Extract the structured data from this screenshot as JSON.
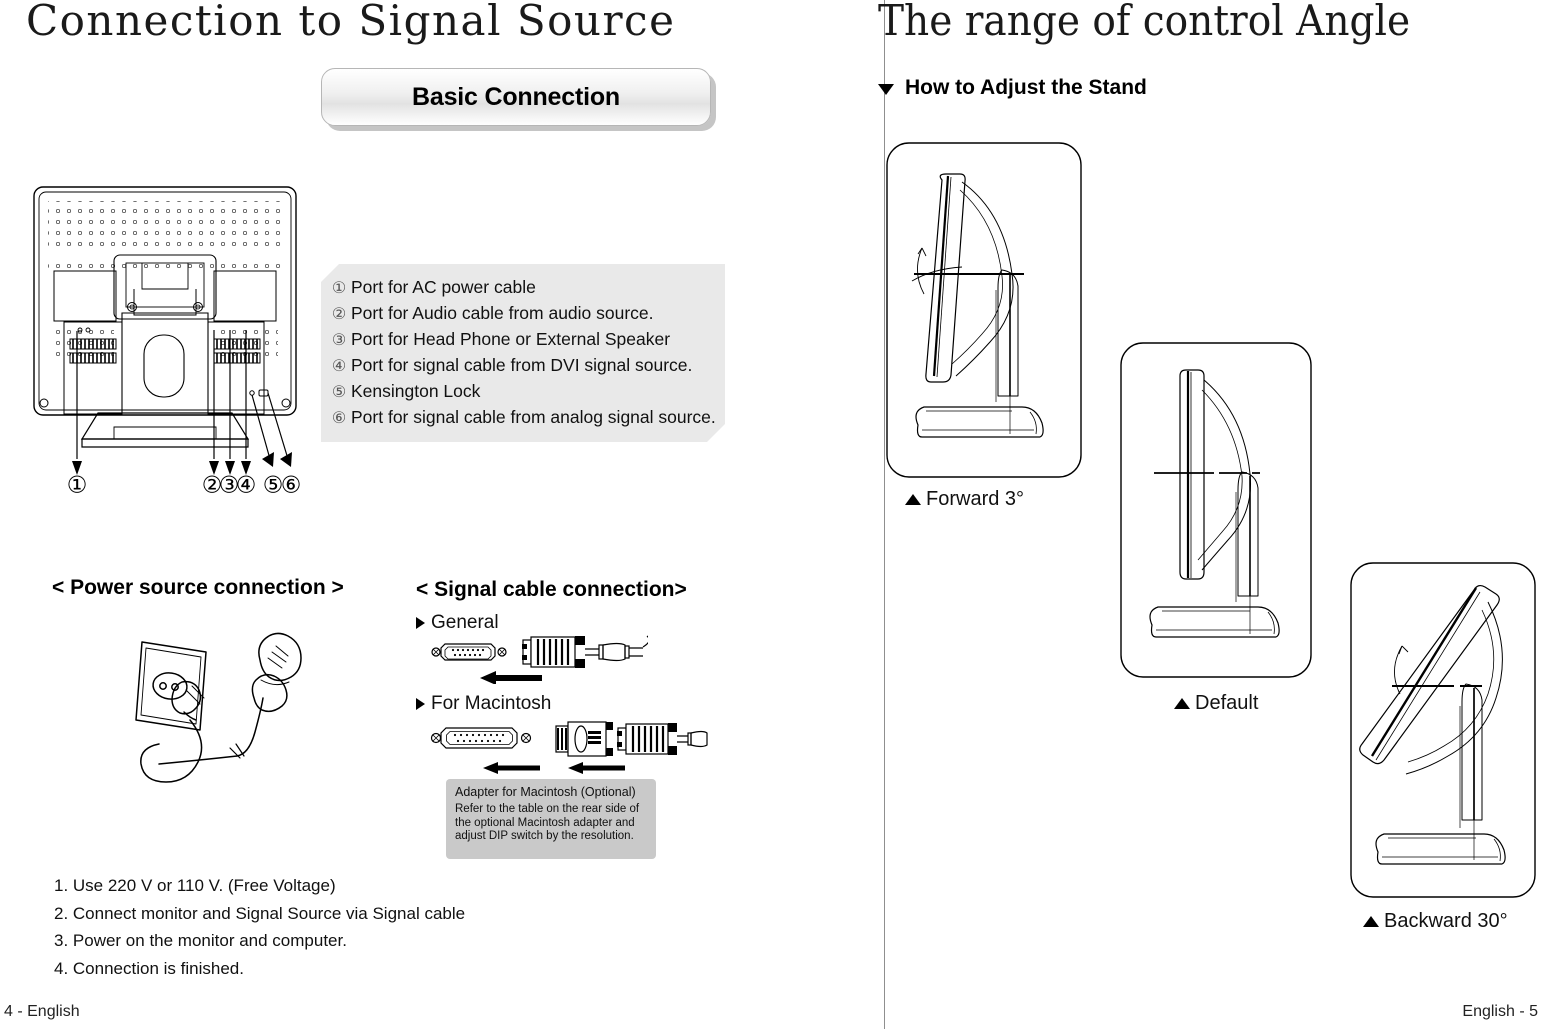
{
  "document": {
    "left_page": {
      "title": "Connection to Signal Source",
      "button_label": "Basic Connection",
      "footer": "4 - English",
      "ports": {
        "items": [
          {
            "number": "①",
            "text": "Port for AC power cable"
          },
          {
            "number": "②",
            "text": "Port for Audio cable  from audio source."
          },
          {
            "number": "③",
            "text": "Port for Head Phone or External Speaker"
          },
          {
            "number": "④",
            "text": "Port for signal cable from DVI signal source."
          },
          {
            "number": "⑤",
            "text": "Kensington Lock"
          },
          {
            "number": "⑥",
            "text": "Port for signal cable from analog signal source."
          }
        ],
        "callout_labels": [
          "①",
          "②",
          "③",
          "④",
          "⑤",
          "⑥"
        ]
      },
      "power_section": {
        "heading": "< Power source connection >"
      },
      "signal_section": {
        "heading": "< Signal cable connection>",
        "general_label": "General",
        "macintosh_label": "For Macintosh",
        "note": {
          "title": "Adapter for Macintosh (Optional)",
          "body": "Refer to the table on the rear side of the optional Macintosh adapter and adjust DIP switch by the resolution."
        }
      },
      "steps": [
        "1. Use 220 V or 110 V. (Free Voltage)",
        "2. Connect monitor and Signal Source via Signal cable",
        "3. Power on the monitor and computer.",
        "4. Connection is finished."
      ]
    },
    "right_page": {
      "title": "The range of control Angle",
      "subheading": "How to Adjust the Stand",
      "footer": "English - 5",
      "stands": [
        {
          "caption": "Forward 3°"
        },
        {
          "caption": "Default"
        },
        {
          "caption": "Backward  30°"
        }
      ]
    },
    "colors": {
      "page_background": "#ffffff",
      "ink": "#1a1a1a",
      "legend_panel": "#e9e9e9",
      "note_panel": "#c9c9c9",
      "divider": "#8f8f8f"
    }
  }
}
